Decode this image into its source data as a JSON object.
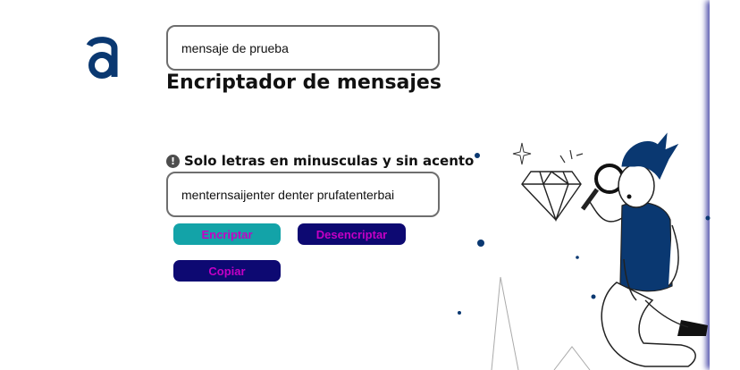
{
  "app": {
    "logo_letter": "a",
    "title": "Encriptador de mensajes"
  },
  "input": {
    "value": "mensaje de prueba"
  },
  "hint": {
    "icon": "exclamation-circle-icon",
    "text": "Solo letras en minusculas y sin acento"
  },
  "output": {
    "value": "menternsaijenter denter prufatenterbai"
  },
  "buttons": {
    "encrypt_label": "Encriptar",
    "decrypt_label": "Desencriptar",
    "copy_label": "Copiar"
  },
  "colors": {
    "brand_navy": "#0a3871",
    "encrypt_button": "#13a3a8",
    "dark_button": "#0d0972",
    "button_text": "#c400c4"
  }
}
